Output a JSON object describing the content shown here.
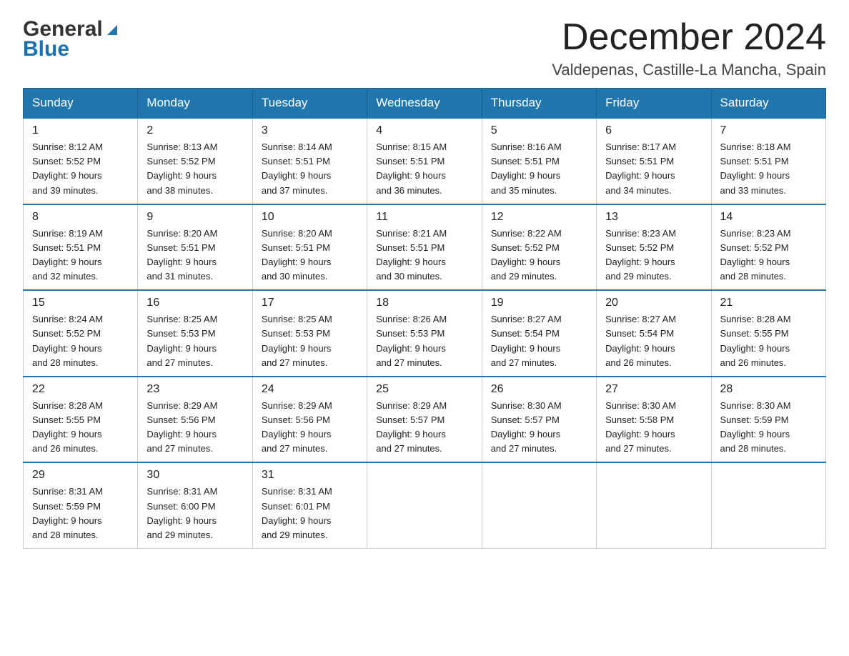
{
  "header": {
    "logo_general": "General",
    "logo_blue": "Blue",
    "month_year": "December 2024",
    "location": "Valdepenas, Castille-La Mancha, Spain"
  },
  "days_of_week": [
    "Sunday",
    "Monday",
    "Tuesday",
    "Wednesday",
    "Thursday",
    "Friday",
    "Saturday"
  ],
  "weeks": [
    [
      {
        "day": "1",
        "sunrise": "8:12 AM",
        "sunset": "5:52 PM",
        "daylight": "9 hours and 39 minutes."
      },
      {
        "day": "2",
        "sunrise": "8:13 AM",
        "sunset": "5:52 PM",
        "daylight": "9 hours and 38 minutes."
      },
      {
        "day": "3",
        "sunrise": "8:14 AM",
        "sunset": "5:51 PM",
        "daylight": "9 hours and 37 minutes."
      },
      {
        "day": "4",
        "sunrise": "8:15 AM",
        "sunset": "5:51 PM",
        "daylight": "9 hours and 36 minutes."
      },
      {
        "day": "5",
        "sunrise": "8:16 AM",
        "sunset": "5:51 PM",
        "daylight": "9 hours and 35 minutes."
      },
      {
        "day": "6",
        "sunrise": "8:17 AM",
        "sunset": "5:51 PM",
        "daylight": "9 hours and 34 minutes."
      },
      {
        "day": "7",
        "sunrise": "8:18 AM",
        "sunset": "5:51 PM",
        "daylight": "9 hours and 33 minutes."
      }
    ],
    [
      {
        "day": "8",
        "sunrise": "8:19 AM",
        "sunset": "5:51 PM",
        "daylight": "9 hours and 32 minutes."
      },
      {
        "day": "9",
        "sunrise": "8:20 AM",
        "sunset": "5:51 PM",
        "daylight": "9 hours and 31 minutes."
      },
      {
        "day": "10",
        "sunrise": "8:20 AM",
        "sunset": "5:51 PM",
        "daylight": "9 hours and 30 minutes."
      },
      {
        "day": "11",
        "sunrise": "8:21 AM",
        "sunset": "5:51 PM",
        "daylight": "9 hours and 30 minutes."
      },
      {
        "day": "12",
        "sunrise": "8:22 AM",
        "sunset": "5:52 PM",
        "daylight": "9 hours and 29 minutes."
      },
      {
        "day": "13",
        "sunrise": "8:23 AM",
        "sunset": "5:52 PM",
        "daylight": "9 hours and 29 minutes."
      },
      {
        "day": "14",
        "sunrise": "8:23 AM",
        "sunset": "5:52 PM",
        "daylight": "9 hours and 28 minutes."
      }
    ],
    [
      {
        "day": "15",
        "sunrise": "8:24 AM",
        "sunset": "5:52 PM",
        "daylight": "9 hours and 28 minutes."
      },
      {
        "day": "16",
        "sunrise": "8:25 AM",
        "sunset": "5:53 PM",
        "daylight": "9 hours and 27 minutes."
      },
      {
        "day": "17",
        "sunrise": "8:25 AM",
        "sunset": "5:53 PM",
        "daylight": "9 hours and 27 minutes."
      },
      {
        "day": "18",
        "sunrise": "8:26 AM",
        "sunset": "5:53 PM",
        "daylight": "9 hours and 27 minutes."
      },
      {
        "day": "19",
        "sunrise": "8:27 AM",
        "sunset": "5:54 PM",
        "daylight": "9 hours and 27 minutes."
      },
      {
        "day": "20",
        "sunrise": "8:27 AM",
        "sunset": "5:54 PM",
        "daylight": "9 hours and 26 minutes."
      },
      {
        "day": "21",
        "sunrise": "8:28 AM",
        "sunset": "5:55 PM",
        "daylight": "9 hours and 26 minutes."
      }
    ],
    [
      {
        "day": "22",
        "sunrise": "8:28 AM",
        "sunset": "5:55 PM",
        "daylight": "9 hours and 26 minutes."
      },
      {
        "day": "23",
        "sunrise": "8:29 AM",
        "sunset": "5:56 PM",
        "daylight": "9 hours and 27 minutes."
      },
      {
        "day": "24",
        "sunrise": "8:29 AM",
        "sunset": "5:56 PM",
        "daylight": "9 hours and 27 minutes."
      },
      {
        "day": "25",
        "sunrise": "8:29 AM",
        "sunset": "5:57 PM",
        "daylight": "9 hours and 27 minutes."
      },
      {
        "day": "26",
        "sunrise": "8:30 AM",
        "sunset": "5:57 PM",
        "daylight": "9 hours and 27 minutes."
      },
      {
        "day": "27",
        "sunrise": "8:30 AM",
        "sunset": "5:58 PM",
        "daylight": "9 hours and 27 minutes."
      },
      {
        "day": "28",
        "sunrise": "8:30 AM",
        "sunset": "5:59 PM",
        "daylight": "9 hours and 28 minutes."
      }
    ],
    [
      {
        "day": "29",
        "sunrise": "8:31 AM",
        "sunset": "5:59 PM",
        "daylight": "9 hours and 28 minutes."
      },
      {
        "day": "30",
        "sunrise": "8:31 AM",
        "sunset": "6:00 PM",
        "daylight": "9 hours and 29 minutes."
      },
      {
        "day": "31",
        "sunrise": "8:31 AM",
        "sunset": "6:01 PM",
        "daylight": "9 hours and 29 minutes."
      },
      null,
      null,
      null,
      null
    ]
  ],
  "labels": {
    "sunrise": "Sunrise:",
    "sunset": "Sunset:",
    "daylight": "Daylight:"
  },
  "colors": {
    "header_bg": "#2176ae",
    "header_text": "#ffffff",
    "border_top": "#2176ae"
  }
}
